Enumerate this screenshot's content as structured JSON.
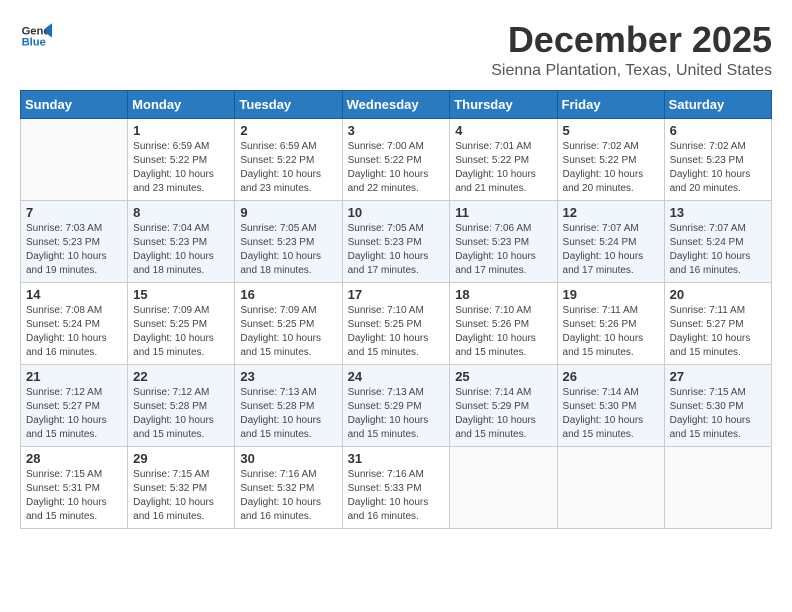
{
  "header": {
    "logo_general": "General",
    "logo_blue": "Blue",
    "title": "December 2025",
    "subtitle": "Sienna Plantation, Texas, United States"
  },
  "days_of_week": [
    "Sunday",
    "Monday",
    "Tuesday",
    "Wednesday",
    "Thursday",
    "Friday",
    "Saturday"
  ],
  "weeks": [
    [
      {
        "day": "",
        "info": ""
      },
      {
        "day": "1",
        "info": "Sunrise: 6:59 AM\nSunset: 5:22 PM\nDaylight: 10 hours\nand 23 minutes."
      },
      {
        "day": "2",
        "info": "Sunrise: 6:59 AM\nSunset: 5:22 PM\nDaylight: 10 hours\nand 23 minutes."
      },
      {
        "day": "3",
        "info": "Sunrise: 7:00 AM\nSunset: 5:22 PM\nDaylight: 10 hours\nand 22 minutes."
      },
      {
        "day": "4",
        "info": "Sunrise: 7:01 AM\nSunset: 5:22 PM\nDaylight: 10 hours\nand 21 minutes."
      },
      {
        "day": "5",
        "info": "Sunrise: 7:02 AM\nSunset: 5:22 PM\nDaylight: 10 hours\nand 20 minutes."
      },
      {
        "day": "6",
        "info": "Sunrise: 7:02 AM\nSunset: 5:23 PM\nDaylight: 10 hours\nand 20 minutes."
      }
    ],
    [
      {
        "day": "7",
        "info": "Sunrise: 7:03 AM\nSunset: 5:23 PM\nDaylight: 10 hours\nand 19 minutes."
      },
      {
        "day": "8",
        "info": "Sunrise: 7:04 AM\nSunset: 5:23 PM\nDaylight: 10 hours\nand 18 minutes."
      },
      {
        "day": "9",
        "info": "Sunrise: 7:05 AM\nSunset: 5:23 PM\nDaylight: 10 hours\nand 18 minutes."
      },
      {
        "day": "10",
        "info": "Sunrise: 7:05 AM\nSunset: 5:23 PM\nDaylight: 10 hours\nand 17 minutes."
      },
      {
        "day": "11",
        "info": "Sunrise: 7:06 AM\nSunset: 5:23 PM\nDaylight: 10 hours\nand 17 minutes."
      },
      {
        "day": "12",
        "info": "Sunrise: 7:07 AM\nSunset: 5:24 PM\nDaylight: 10 hours\nand 17 minutes."
      },
      {
        "day": "13",
        "info": "Sunrise: 7:07 AM\nSunset: 5:24 PM\nDaylight: 10 hours\nand 16 minutes."
      }
    ],
    [
      {
        "day": "14",
        "info": "Sunrise: 7:08 AM\nSunset: 5:24 PM\nDaylight: 10 hours\nand 16 minutes."
      },
      {
        "day": "15",
        "info": "Sunrise: 7:09 AM\nSunset: 5:25 PM\nDaylight: 10 hours\nand 15 minutes."
      },
      {
        "day": "16",
        "info": "Sunrise: 7:09 AM\nSunset: 5:25 PM\nDaylight: 10 hours\nand 15 minutes."
      },
      {
        "day": "17",
        "info": "Sunrise: 7:10 AM\nSunset: 5:25 PM\nDaylight: 10 hours\nand 15 minutes."
      },
      {
        "day": "18",
        "info": "Sunrise: 7:10 AM\nSunset: 5:26 PM\nDaylight: 10 hours\nand 15 minutes."
      },
      {
        "day": "19",
        "info": "Sunrise: 7:11 AM\nSunset: 5:26 PM\nDaylight: 10 hours\nand 15 minutes."
      },
      {
        "day": "20",
        "info": "Sunrise: 7:11 AM\nSunset: 5:27 PM\nDaylight: 10 hours\nand 15 minutes."
      }
    ],
    [
      {
        "day": "21",
        "info": "Sunrise: 7:12 AM\nSunset: 5:27 PM\nDaylight: 10 hours\nand 15 minutes."
      },
      {
        "day": "22",
        "info": "Sunrise: 7:12 AM\nSunset: 5:28 PM\nDaylight: 10 hours\nand 15 minutes."
      },
      {
        "day": "23",
        "info": "Sunrise: 7:13 AM\nSunset: 5:28 PM\nDaylight: 10 hours\nand 15 minutes."
      },
      {
        "day": "24",
        "info": "Sunrise: 7:13 AM\nSunset: 5:29 PM\nDaylight: 10 hours\nand 15 minutes."
      },
      {
        "day": "25",
        "info": "Sunrise: 7:14 AM\nSunset: 5:29 PM\nDaylight: 10 hours\nand 15 minutes."
      },
      {
        "day": "26",
        "info": "Sunrise: 7:14 AM\nSunset: 5:30 PM\nDaylight: 10 hours\nand 15 minutes."
      },
      {
        "day": "27",
        "info": "Sunrise: 7:15 AM\nSunset: 5:30 PM\nDaylight: 10 hours\nand 15 minutes."
      }
    ],
    [
      {
        "day": "28",
        "info": "Sunrise: 7:15 AM\nSunset: 5:31 PM\nDaylight: 10 hours\nand 15 minutes."
      },
      {
        "day": "29",
        "info": "Sunrise: 7:15 AM\nSunset: 5:32 PM\nDaylight: 10 hours\nand 16 minutes."
      },
      {
        "day": "30",
        "info": "Sunrise: 7:16 AM\nSunset: 5:32 PM\nDaylight: 10 hours\nand 16 minutes."
      },
      {
        "day": "31",
        "info": "Sunrise: 7:16 AM\nSunset: 5:33 PM\nDaylight: 10 hours\nand 16 minutes."
      },
      {
        "day": "",
        "info": ""
      },
      {
        "day": "",
        "info": ""
      },
      {
        "day": "",
        "info": ""
      }
    ]
  ]
}
